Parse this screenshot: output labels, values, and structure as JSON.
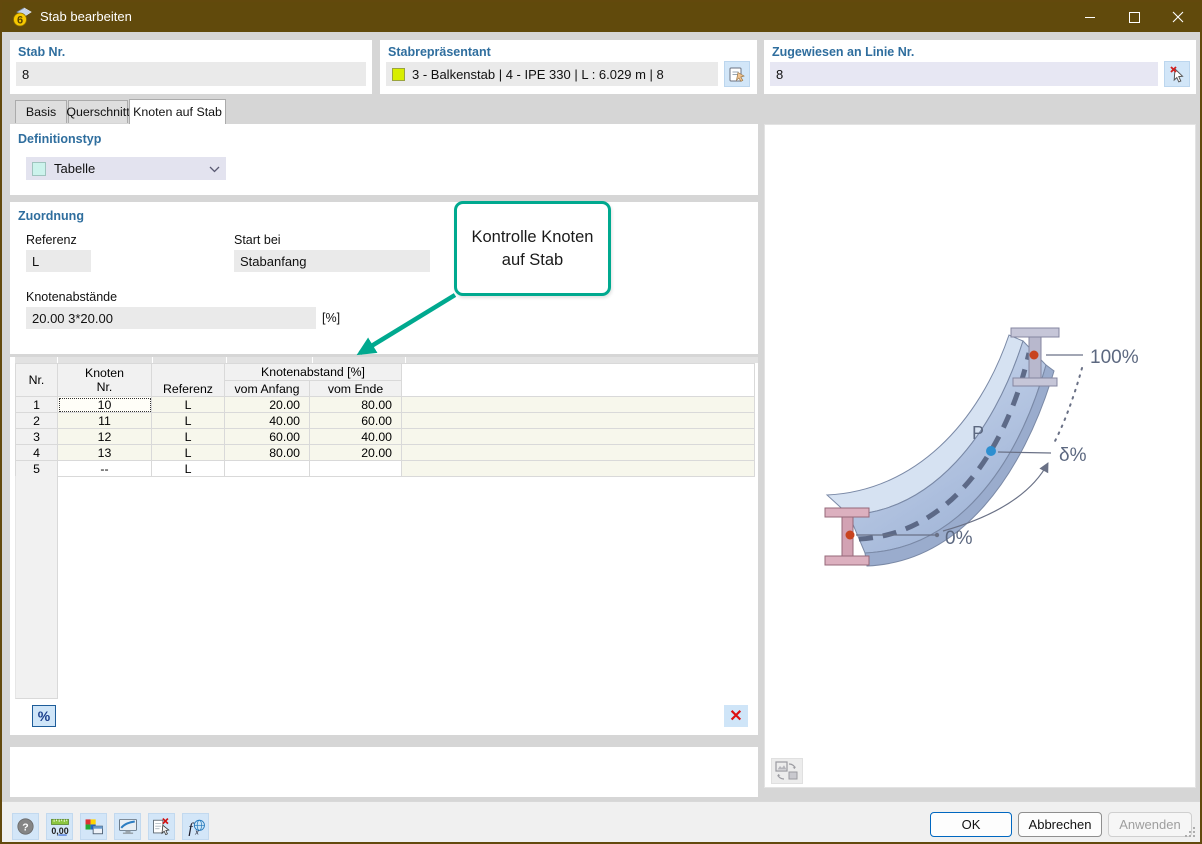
{
  "window": {
    "title": "Stab bearbeiten"
  },
  "header": {
    "stab_nr": {
      "label": "Stab Nr.",
      "value": "8"
    },
    "repraesentant": {
      "label": "Stabrepräsentant",
      "value": "3 - Balkenstab | 4 - IPE 330 | L : 6.029 m | 8",
      "swatch_color": "#d8ee00"
    },
    "linie": {
      "label": "Zugewiesen an Linie Nr.",
      "value": "8"
    }
  },
  "tabs": [
    {
      "label": "Basis",
      "active": false
    },
    {
      "label": "Querschnitt",
      "active": false
    },
    {
      "label": "Knoten auf Stab",
      "active": true
    }
  ],
  "definitionstyp": {
    "label": "Definitionstyp",
    "value": "Tabelle",
    "swatch_color": "#ccf3ec"
  },
  "zuordnung": {
    "label": "Zuordnung",
    "referenz": {
      "label": "Referenz",
      "value": "L"
    },
    "start_bei": {
      "label": "Start bei",
      "value": "Stabanfang"
    },
    "knotenabstaende": {
      "label": "Knotenabstände",
      "value": "20.00 3*20.00",
      "unit": "[%]"
    }
  },
  "callout": {
    "line1": "Kontrolle Knoten",
    "line2": "auf Stab",
    "color": "#00a98f"
  },
  "table": {
    "headers": {
      "nr": "Nr.",
      "knoten_line1": "Knoten",
      "knoten_line2": "Nr.",
      "referenz": "Referenz",
      "group": "Knotenabstand [%]",
      "vom_anfang": "vom Anfang",
      "vom_ende": "vom Ende"
    },
    "rows": [
      {
        "nr": "1",
        "knoten": "10",
        "referenz": "L",
        "vom_anfang": "20.00",
        "vom_ende": "80.00"
      },
      {
        "nr": "2",
        "knoten": "11",
        "referenz": "L",
        "vom_anfang": "40.00",
        "vom_ende": "60.00"
      },
      {
        "nr": "3",
        "knoten": "12",
        "referenz": "L",
        "vom_anfang": "60.00",
        "vom_ende": "40.00"
      },
      {
        "nr": "4",
        "knoten": "13",
        "referenz": "L",
        "vom_anfang": "80.00",
        "vom_ende": "20.00"
      },
      {
        "nr": "5",
        "knoten": "--",
        "referenz": "L",
        "vom_anfang": "",
        "vom_ende": ""
      }
    ],
    "percent_button": "%",
    "delete_icon": "✕"
  },
  "illustration": {
    "label_100": "100%",
    "label_delta": "δ%",
    "label_0": "0%",
    "label_p": "P"
  },
  "footer": {
    "ok": "OK",
    "cancel": "Abbrechen",
    "apply": "Anwenden"
  },
  "icons": {
    "titlebar": [
      "app-icon",
      "minimize-icon",
      "maximize-icon",
      "close-icon"
    ],
    "header": [
      "pick-representative-icon",
      "deselect-line-icon"
    ],
    "toolbar": [
      "help-icon",
      "decimal-places-icon",
      "display-properties-icon",
      "monitor-icon",
      "delete-selection-icon",
      "formula-icon"
    ],
    "right_panel": [
      "image-3d-toggle-icon"
    ],
    "misc": [
      "chevron-down-icon",
      "resize-grip"
    ]
  },
  "colors": {
    "titlebar": "#614a0c",
    "label_blue": "#2f6e9e",
    "accent_teal": "#00a98f",
    "swatch_yellow": "#d8ee00",
    "swatch_cyan": "#ccf3ec",
    "table_row": "#f7f7ec"
  }
}
